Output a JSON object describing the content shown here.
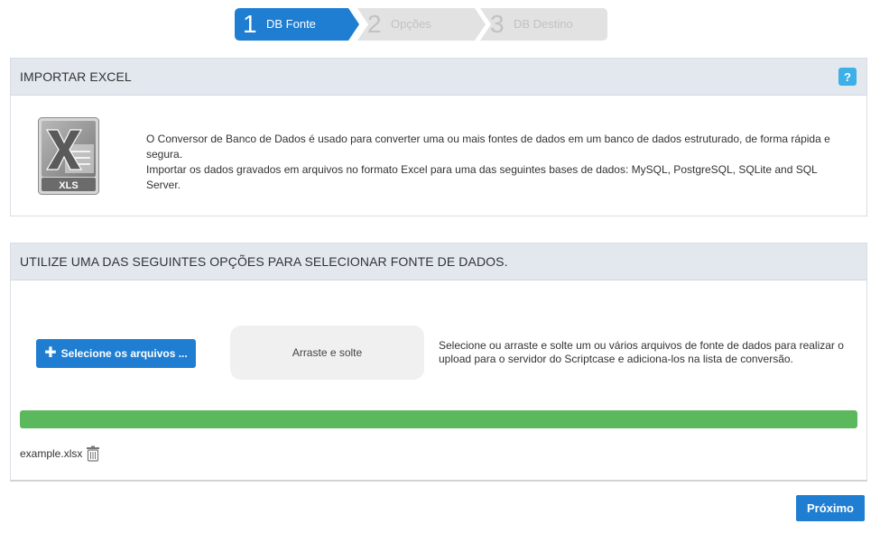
{
  "wizard": {
    "steps": [
      {
        "number": "1",
        "label": "DB Fonte",
        "state": "active"
      },
      {
        "number": "2",
        "label": "Opções",
        "state": "inactive"
      },
      {
        "number": "3",
        "label": "DB Destino",
        "state": "inactive"
      }
    ]
  },
  "import_panel": {
    "title": "IMPORTAR EXCEL",
    "help_label": "?",
    "icon_label": "XLS",
    "description_line1": "O Conversor de Banco de Dados é usado para converter uma ou mais fontes de dados em um banco de dados estruturado, de forma rápida e segura.",
    "description_line2": "Importar os dados gravados em arquivos no formato Excel para uma das seguintes bases de dados: MySQL, PostgreSQL, SQLite and SQL Server."
  },
  "source_panel": {
    "title": "UTILIZE UMA DAS SEGUINTES OPÇÕES PARA SELECIONAR FONTE DE DADOS.",
    "select_button": "Selecione os arquivos ...",
    "select_button_icon": "plus-icon",
    "dropzone_label": "Arraste e solte",
    "help_text": "Selecione ou arraste e solte um ou vários arquivos de fonte de dados para realizar o upload para o servidor do Scriptcase e adiciona-los na lista de conversão.",
    "upload_progress": 1.0,
    "files": [
      {
        "name": "example.xlsx",
        "action_icon": "trash-icon"
      }
    ]
  },
  "footer": {
    "next_button": "Próximo"
  },
  "colors": {
    "accent": "#1f7ed1",
    "panel_header": "#e3e8ef",
    "progress": "#5cb85c",
    "help": "#3db0e8"
  }
}
